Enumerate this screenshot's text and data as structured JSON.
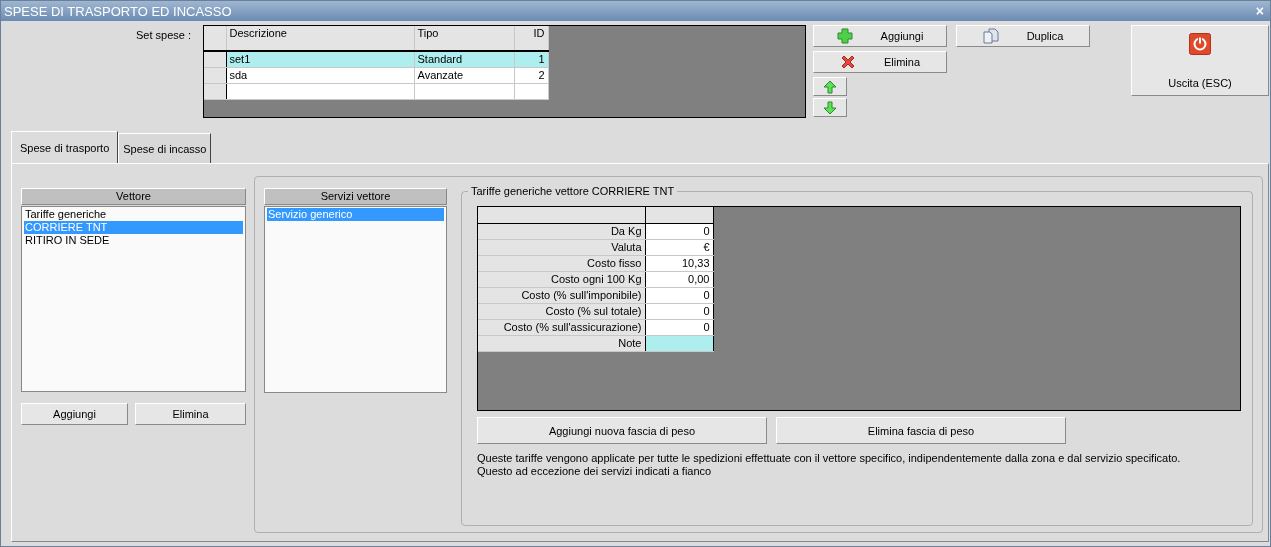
{
  "window": {
    "title": "SPESE DI TRASPORTO ED INCASSO",
    "close": "×"
  },
  "set_spese": {
    "label": "Set spese :",
    "columns": [
      "Descrizione",
      "Tipo",
      "ID"
    ],
    "rows": [
      {
        "descrizione": "set1",
        "tipo": "Standard",
        "id": "1",
        "selected": true
      },
      {
        "descrizione": "sda",
        "tipo": "Avanzate",
        "id": "2",
        "selected": false
      }
    ]
  },
  "actions": [
    {
      "kind": "add",
      "label": "Aggiungi"
    },
    {
      "kind": "delete",
      "label": "Elimina"
    },
    {
      "kind": "up"
    },
    {
      "kind": "down"
    },
    {
      "kind": "duplicate",
      "label": "Duplica"
    },
    {
      "kind": "exit",
      "label": "Uscita (ESC)"
    }
  ],
  "tabs": [
    {
      "label": "Spese di trasporto",
      "selected": true
    },
    {
      "label": "Spese di incasso",
      "selected": false
    }
  ],
  "vettore": {
    "header": "Vettore",
    "items": [
      {
        "label": "Tariffe generiche",
        "selected": false
      },
      {
        "label": "CORRIERE TNT",
        "selected": true
      },
      {
        "label": "RITIRO IN SEDE",
        "selected": false
      }
    ],
    "buttons": [
      "Aggiungi",
      "Elimina"
    ]
  },
  "servizi": {
    "header": "Servizi vettore",
    "items": [
      {
        "label": "Servizio generico",
        "selected": true
      }
    ]
  },
  "tariffe": {
    "title": "Tariffe generiche vettore CORRIERE TNT",
    "rows": [
      {
        "label": "Da Kg",
        "value": "0",
        "selected": false
      },
      {
        "label": "Valuta",
        "value": "€",
        "selected": false
      },
      {
        "label": "Costo fisso",
        "value": "10,33",
        "selected": false
      },
      {
        "label": "Costo ogni 100 Kg",
        "value": "0,00",
        "selected": false
      },
      {
        "label": "Costo (% sull'imponibile)",
        "value": "0",
        "selected": false
      },
      {
        "label": "Costo (% sul totale)",
        "value": "0",
        "selected": false
      },
      {
        "label": "Costo (% sull'assicurazione)",
        "value": "0",
        "selected": false
      },
      {
        "label": "Note",
        "selected": true
      }
    ],
    "buttons": [
      "Aggiungi nuova fascia di peso",
      "Elimina fascia di peso"
    ],
    "notes": [
      "Queste tariffe vengono applicate per tutte le spedizioni effettuate con il vettore specifico, indipendentemente dalla zona e dal servizio specificato.",
      "Questo ad eccezione dei servizi indicati a fianco"
    ]
  }
}
